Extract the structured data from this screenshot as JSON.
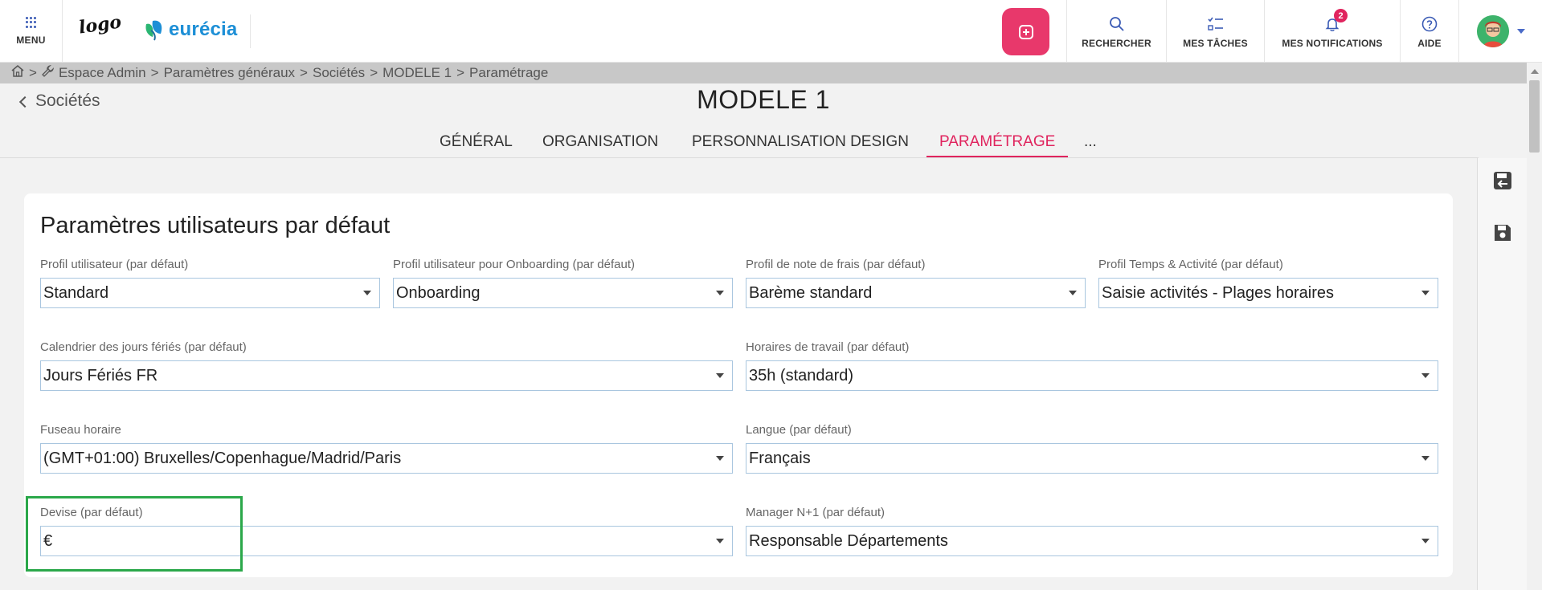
{
  "topbar": {
    "menu_label": "MENU",
    "logo_text": "logo",
    "brand_name": "eurécia",
    "nav": {
      "search_label": "RECHERCHER",
      "tasks_label": "MES TÂCHES",
      "notifications_label": "MES NOTIFICATIONS",
      "notifications_count": "2",
      "help_label": "AIDE"
    },
    "accent_color": "#e8386b"
  },
  "breadcrumb": {
    "sep": ">",
    "items": [
      "Espace Admin",
      "Paramètres généraux",
      "Sociétés",
      "MODELE 1",
      "Paramétrage"
    ]
  },
  "header": {
    "back_label": "Sociétés",
    "title": "MODELE 1",
    "tabs": [
      "GÉNÉRAL",
      "ORGANISATION",
      "PERSONNALISATION DESIGN",
      "PARAMÉTRAGE",
      "..."
    ],
    "active_tab": "PARAMÉTRAGE"
  },
  "card": {
    "title": "Paramètres utilisateurs par défaut",
    "fields": {
      "profil_utilisateur": {
        "label": "Profil utilisateur (par défaut)",
        "value": "Standard"
      },
      "profil_onboarding": {
        "label": "Profil utilisateur pour Onboarding (par défaut)",
        "value": "Onboarding"
      },
      "profil_note_frais": {
        "label": "Profil de note de frais (par défaut)",
        "value": "Barème standard"
      },
      "profil_temps": {
        "label": "Profil Temps & Activité (par défaut)",
        "value": "Saisie activités - Plages horaires"
      },
      "calendrier": {
        "label": "Calendrier des jours fériés (par défaut)",
        "value": "Jours Fériés FR"
      },
      "horaires": {
        "label": "Horaires de travail (par défaut)",
        "value": "35h (standard)"
      },
      "fuseau": {
        "label": "Fuseau horaire",
        "value": "(GMT+01:00) Bruxelles/Copenhague/Madrid/Paris"
      },
      "langue": {
        "label": "Langue (par défaut)",
        "value": "Français"
      },
      "devise": {
        "label": "Devise (par défaut)",
        "value": "€"
      },
      "manager": {
        "label": "Manager N+1 (par défaut)",
        "value": "Responsable Départements"
      }
    }
  },
  "highlight_color": "#2ba84a"
}
